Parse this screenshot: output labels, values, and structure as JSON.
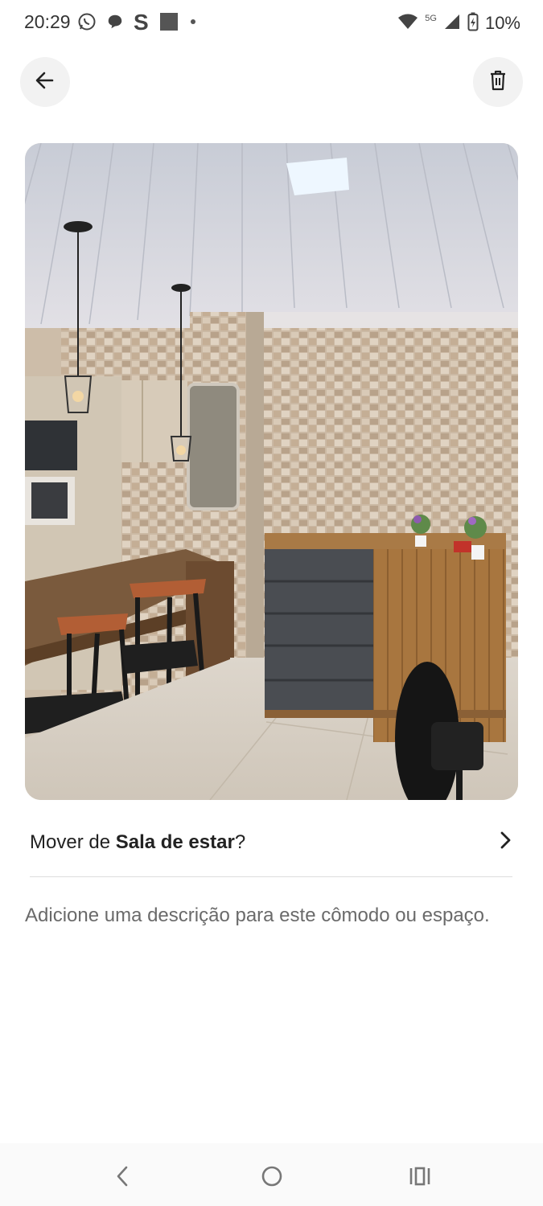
{
  "status_bar": {
    "time": "20:29",
    "network": "5G",
    "battery": "10%",
    "app_icons": [
      "whatsapp-icon",
      "chat-bubble-icon",
      "s-app-icon",
      "square-icon",
      "dot-icon"
    ]
  },
  "header": {
    "back_icon": "arrow-left-icon",
    "delete_icon": "trash-icon"
  },
  "photo": {
    "subject": "kitchen-room-photo"
  },
  "move_row": {
    "prefix": "Mover de ",
    "room": "Sala de estar",
    "suffix": "?"
  },
  "description_placeholder": "Adicione uma descrição para este cômodo ou espaço.",
  "nav": {
    "items": [
      "back-nav-icon",
      "home-nav-icon",
      "recents-nav-icon"
    ]
  }
}
